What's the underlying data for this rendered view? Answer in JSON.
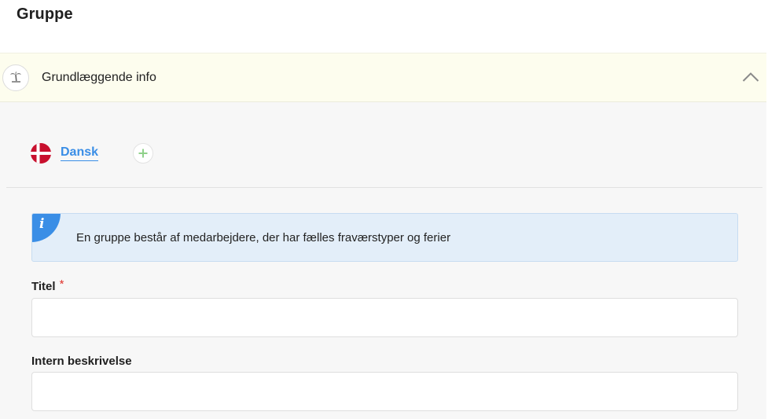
{
  "page": {
    "title": "Gruppe"
  },
  "section": {
    "title": "Grundlæggende info",
    "icon": "palm-tree-icon",
    "expanded": true
  },
  "languages": {
    "items": [
      {
        "label": "Dansk",
        "flag": "denmark-flag-icon",
        "active": true
      }
    ]
  },
  "info": {
    "icon": "info-icon",
    "icon_glyph": "i",
    "text": "En gruppe består af medarbejdere, der har fælles fraværstyper og ferier"
  },
  "form": {
    "title_field": {
      "label": "Titel",
      "required_mark": "*",
      "value": ""
    },
    "description_field": {
      "label": "Intern beskrivelse",
      "value": ""
    }
  },
  "colors": {
    "accent": "#3a8ee6",
    "header_bg": "#fdfdee",
    "body_bg": "#f7f7f7",
    "info_bg": "#e3eef9",
    "required": "#e0322b",
    "add_icon": "#8fd18a"
  }
}
